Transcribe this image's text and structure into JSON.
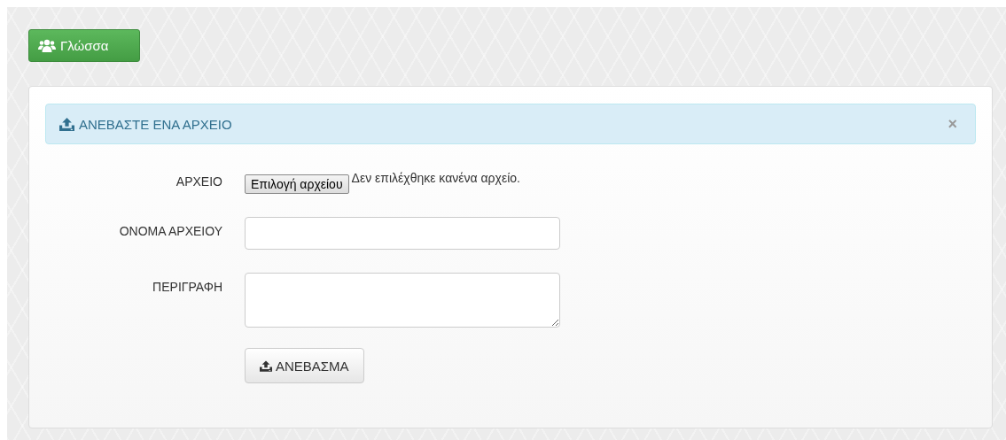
{
  "language_button": {
    "label": "Γλώσσα"
  },
  "upload_panel": {
    "alert": {
      "title": "ΑΝΕΒΑΣΤΕ ΕΝΑ ΑΡΧΕΙΟ",
      "close": "×"
    },
    "fields": [
      {
        "kind": "file",
        "label": "ΑΡΧΕΙΟ",
        "button": "Επιλογή αρχείου",
        "status": "Δεν επιλέχθηκε κανένα αρχείο."
      },
      {
        "kind": "text",
        "label": "ΟΝΟΜΑ ΑΡΧΕΙΟΥ"
      },
      {
        "kind": "textarea",
        "label": "ΠΕΡΙΓΡΑΦΗ"
      }
    ],
    "submit": {
      "label": "ΑΝΕΒΑΣΜΑ"
    }
  }
}
